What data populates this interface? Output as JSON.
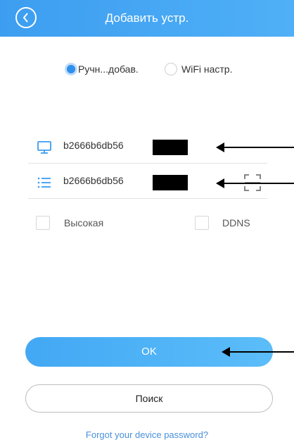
{
  "header": {
    "title": "Добавить устр.",
    "back_icon": "chevron-left-icon"
  },
  "mode": {
    "manual_label": "Ручн...добав.",
    "wifi_label": "WiFi настр.",
    "selected": "manual"
  },
  "fields": {
    "device_id": {
      "value": "b2666b6db56",
      "icon": "monitor-icon"
    },
    "serial": {
      "value": "b2666b6db56",
      "icon": "list-icon",
      "scan_icon": "scan-icon"
    }
  },
  "options": {
    "high_label": "Высокая",
    "ddns_label": "DDNS"
  },
  "buttons": {
    "ok_label": "OK",
    "search_label": "Поиск"
  },
  "links": {
    "forgot_label": "Forgot your device password?"
  },
  "colors": {
    "accent": "#3d9df0",
    "text": "#333333",
    "link": "#4a90d9"
  }
}
